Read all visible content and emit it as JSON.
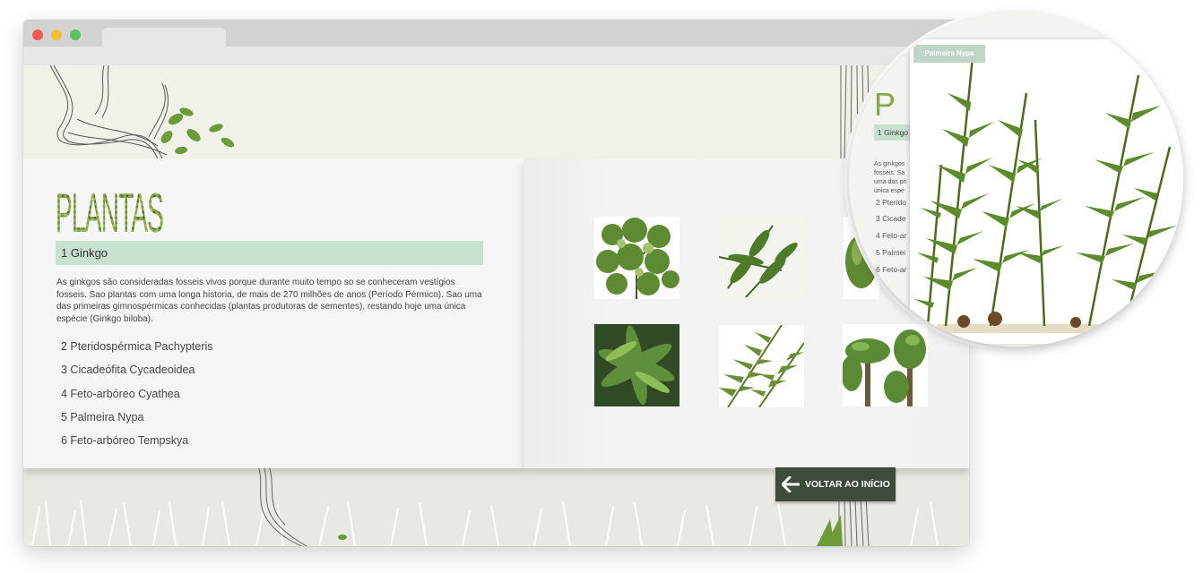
{
  "page": {
    "title_logo": "PLANTAS",
    "active_item": "1 Ginkgo",
    "description": "As ginkgos são consideradas fosseis vivos porque durante muito tempo so se conheceram vestígios fosseis. Sao plantas com uma longa historia, de mais de 270 milhões de anos (Período Pérmico). Sao uma das primeiras gimnospérmicas conhecidas (plantas produtoras de sementes), restando hoje uma única espécie (Ginkgo biloba).",
    "items": [
      "2 Pteridospérmica Pachypteris",
      "3 Cicadeófita Cycadeoidea",
      "4 Feto-arbóreo Cyathea",
      "5 Palmeira Nypa",
      "6 Feto-arbóreo Tempskya"
    ],
    "back_button": "VOLTAR AO INÍCIO"
  },
  "magnifier": {
    "label": "Palmeira Nypa",
    "active_item": "1 Ginkgo",
    "desc_fragment": "As ginkgos fosseis. Sa uma das pri única espé",
    "items": [
      "2 Pterido",
      "3 Cicade",
      "4 Feto-ar",
      "5 Palmei",
      "6 Feto-ar"
    ]
  },
  "colors": {
    "accent_green": "#c8e0cf",
    "button_dark": "#3d4a3c"
  }
}
